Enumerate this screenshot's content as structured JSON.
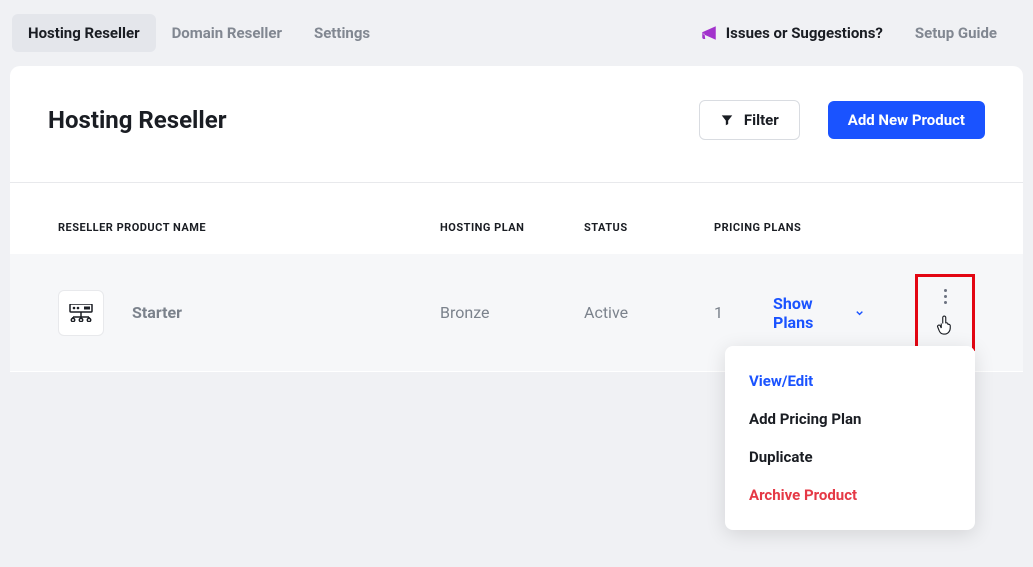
{
  "nav": {
    "tabs": [
      {
        "label": "Hosting Reseller",
        "active": true
      },
      {
        "label": "Domain Reseller",
        "active": false
      },
      {
        "label": "Settings",
        "active": false
      }
    ],
    "issues_link": "Issues or Suggestions?",
    "setup_guide": "Setup Guide"
  },
  "header": {
    "title": "Hosting Reseller",
    "filter_label": "Filter",
    "add_product_label": "Add New Product"
  },
  "table": {
    "columns": {
      "name": "RESELLER PRODUCT NAME",
      "plan": "HOSTING PLAN",
      "status": "STATUS",
      "pricing": "PRICING PLANS"
    },
    "rows": [
      {
        "name": "Starter",
        "plan": "Bronze",
        "status": "Active",
        "pricing_count": "1",
        "show_plans_label": "Show Plans"
      }
    ]
  },
  "dropdown": {
    "items": [
      {
        "label": "View/Edit",
        "tone": "blue"
      },
      {
        "label": "Add Pricing Plan",
        "tone": "dark"
      },
      {
        "label": "Duplicate",
        "tone": "dark"
      },
      {
        "label": "Archive Product",
        "tone": "red"
      }
    ]
  }
}
